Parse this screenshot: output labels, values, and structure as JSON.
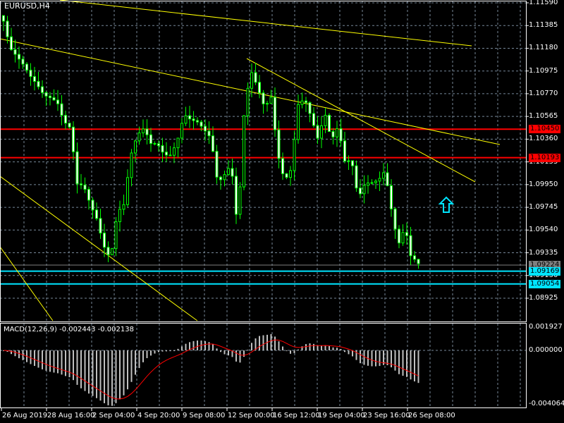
{
  "chart_title": "EURUSD,H4",
  "macd_label": "MACD(12,26,9) -0.002443 -0.002138",
  "colors": {
    "background": "#000000",
    "grid": "#778899",
    "bull_body": "#000000",
    "bear_body": "#ffffff",
    "wick": "#00ff00",
    "trendline": "#ffff00",
    "resistance": "#ff0000",
    "support": "#00e5ff",
    "bid": "#808080",
    "histogram": "#c0c0c0",
    "signal": "#ff0000"
  },
  "price_axis": {
    "ticks": [
      "1.11590",
      "1.11385",
      "1.11180",
      "1.10975",
      "1.10770",
      "1.10565",
      "1.10360",
      "1.10155",
      "1.09950",
      "1.09745",
      "1.09540",
      "1.09335",
      "1.09130",
      "1.08925"
    ],
    "range": [
      1.08925,
      1.1159
    ]
  },
  "price_tags": [
    {
      "value": "1.10450",
      "kind": "resistance"
    },
    {
      "value": "1.10193",
      "kind": "resistance"
    },
    {
      "value": "1.09224",
      "kind": "bid"
    },
    {
      "value": "1.09169",
      "kind": "support"
    },
    {
      "value": "1.09054",
      "kind": "support"
    }
  ],
  "macd_axis": {
    "ticks": [
      "0.001927",
      "0.000000",
      "-0.004064"
    ]
  },
  "time_axis": [
    "26 Aug 2019",
    "28 Aug 16:00",
    "2 Sep 04:00",
    "4 Sep 20:00",
    "9 Sep 08:00",
    "12 Sep 00:00",
    "16 Sep 12:00",
    "19 Sep 04:00",
    "23 Sep 16:00",
    "26 Sep 08:00"
  ],
  "arrow_icon": "up-arrow-icon",
  "chart_data": {
    "type": "candlestick",
    "symbol": "EURUSD",
    "timeframe": "H4",
    "closes": [
      1.11425,
      1.11138,
      1.11043,
      1.10979,
      1.10916,
      1.10884,
      1.1082,
      1.10789,
      1.10725,
      1.10502,
      1.10407,
      1.09898,
      1.09898,
      1.09771,
      1.09676,
      1.09453,
      1.09326,
      1.09707,
      1.09739,
      1.10153,
      1.10343,
      1.10439,
      1.10343,
      1.10375,
      1.1028,
      1.10248,
      1.10343,
      1.10534,
      1.10471,
      1.10471,
      1.10439,
      1.10407,
      1.10025,
      1.10089,
      1.10153,
      1.09517,
      1.10598,
      1.10916,
      1.10789,
      1.10661,
      1.10789,
      1.1028,
      1.10025,
      1.10089,
      1.1063,
      1.10661,
      1.10502,
      1.10343,
      1.1063,
      1.10407,
      1.10534,
      1.10184,
      1.10153,
      1.09771,
      1.09898,
      1.0993,
      1.09994,
      1.10121,
      1.09771,
      1.09453,
      1.0958,
      1.09224,
      1.09236
    ],
    "trendlines": [
      {
        "from": [
          1.1159,
          "26 Aug"
        ],
        "to": [
          1.1019,
          "end"
        ]
      },
      {
        "from": [
          1.1159,
          "12 Sep"
        ],
        "to": [
          1.1119,
          "end"
        ]
      }
    ],
    "horizontal_levels": [
      1.1045,
      1.10193,
      1.09224,
      1.09169,
      1.09054
    ],
    "macd": {
      "fast": 12,
      "slow": 26,
      "signal": 9,
      "main": -0.002443,
      "signal_value": -0.002138,
      "range": [
        -0.004064,
        0.001927
      ]
    }
  }
}
